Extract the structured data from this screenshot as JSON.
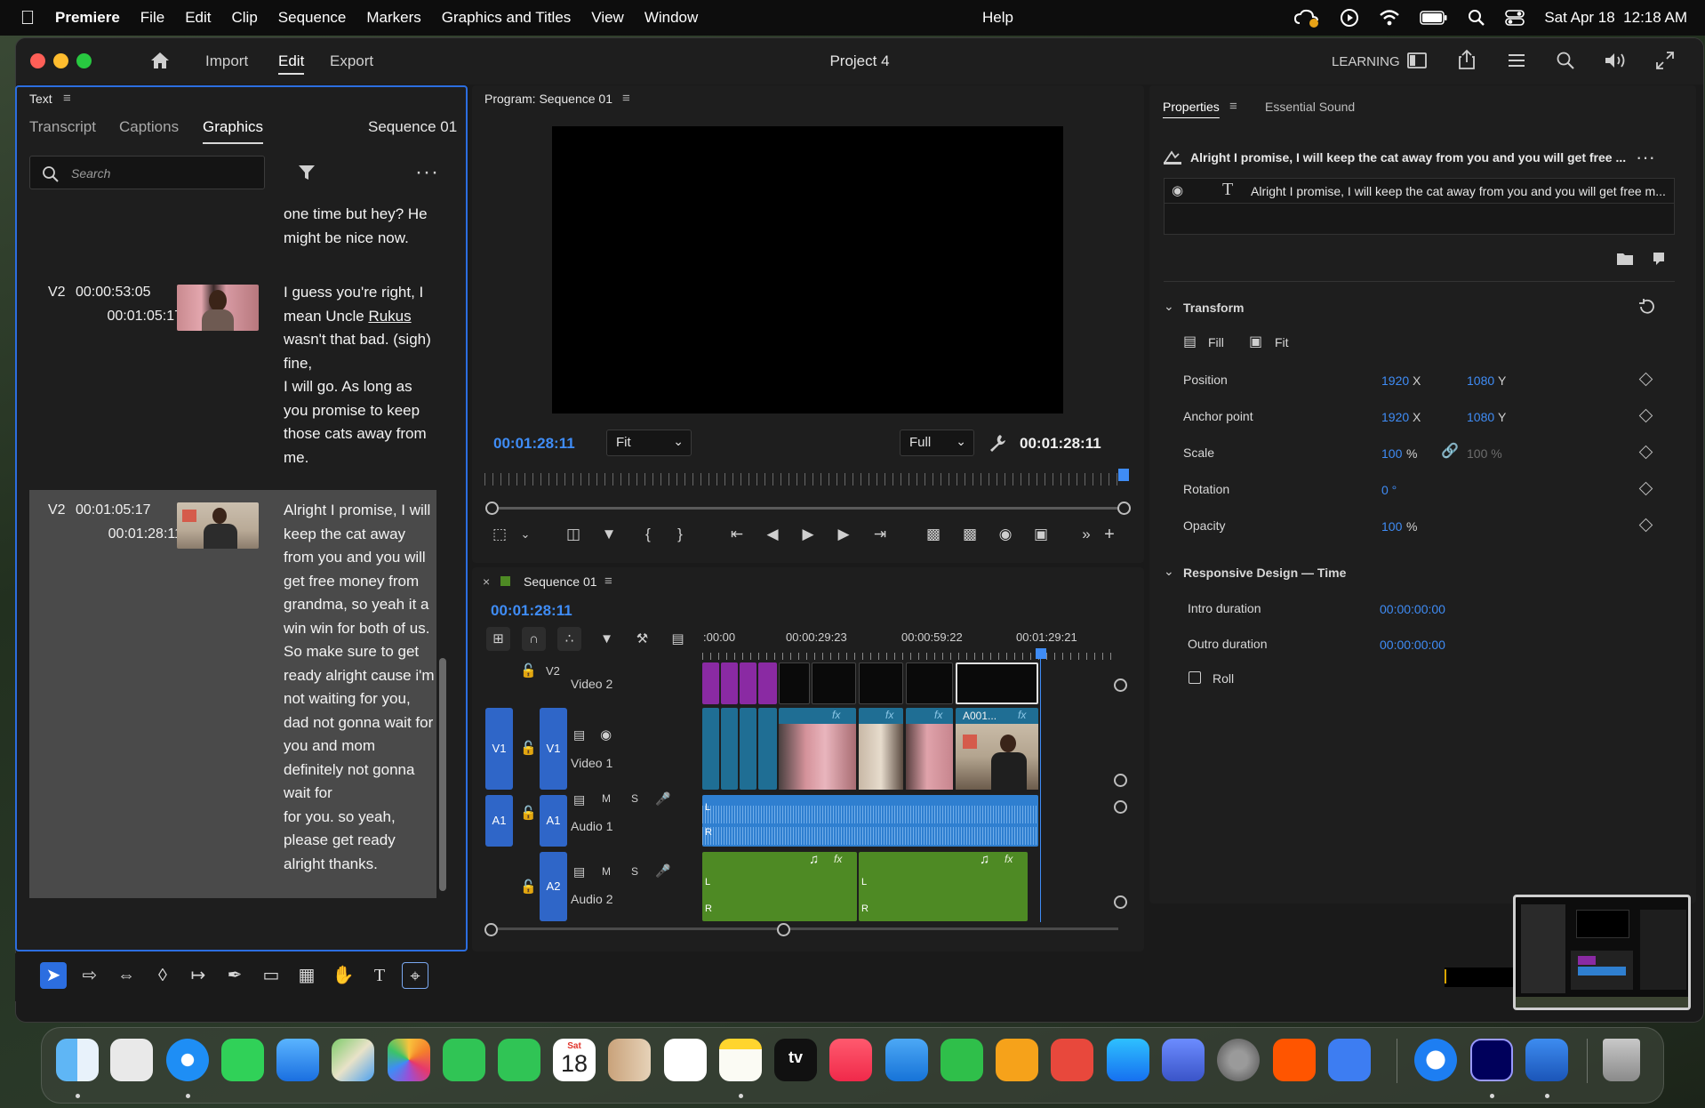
{
  "menubar": {
    "app_name": "Premiere",
    "items": [
      "File",
      "Edit",
      "Clip",
      "Sequence",
      "Markers",
      "Graphics and Titles",
      "View",
      "Window",
      "Help"
    ],
    "clock": "Sat Apr 18  12:18 AM"
  },
  "window": {
    "project_title": "Project 4",
    "nav": {
      "import": "Import",
      "edit": "Edit",
      "export": "Export"
    },
    "learning_label": "LEARNING"
  },
  "text_panel": {
    "title": "Text",
    "tabs": [
      "Transcript",
      "Captions",
      "Graphics"
    ],
    "active_tab": "Graphics",
    "sequence_label": "Sequence 01",
    "search_placeholder": "Search",
    "captions": [
      {
        "text": "one time but hey? He\nmight be nice now."
      },
      {
        "track": "V2",
        "in": "00:00:53:05",
        "out": "00:01:05:17",
        "text_before": "I guess you're right, I\nmean Uncle ",
        "underlined": "Rukus",
        "text_after": "\nwasn't that bad. (sigh)\nfine,\nI will go. As long as\nyou promise to keep\nthose cats away from\nme."
      },
      {
        "track": "V2",
        "in": "00:01:05:17",
        "out": "00:01:28:11",
        "text": "Alright I promise, I will\nkeep the cat away\nfrom you and you will\nget free money from\ngrandma, so yeah it a\nwin win for both of us.\nSo make sure to get\nready alright cause i'm\nnot waiting for you,\ndad not gonna wait for\nyou and mom\ndefinitely not gonna\nwait for\nfor you. so yeah,\nplease get ready\nalright thanks."
      }
    ]
  },
  "program_monitor": {
    "title": "Program: Sequence 01",
    "current_time": "00:01:28:11",
    "duration": "00:01:28:11",
    "fit_label": "Fit",
    "quality_label": "Full"
  },
  "timeline": {
    "close_label": "×",
    "sequence_name": "Sequence 01",
    "current_time": "00:01:28:11",
    "ruler_labels": [
      ":00:00",
      "00:00:29:23",
      "00:00:59:22",
      "00:01:29:21"
    ],
    "tracks": {
      "v2": {
        "label": "V2",
        "name": "Video 2"
      },
      "v1": {
        "source": "V1",
        "label": "V1",
        "name": "Video 1"
      },
      "a1": {
        "source": "A1",
        "label": "A1",
        "name": "Audio 1",
        "mute": "M",
        "solo": "S"
      },
      "a2": {
        "label": "A2",
        "name": "Audio 2",
        "mute": "M",
        "solo": "S"
      }
    },
    "clip_label": "A001...",
    "fx_label": "fx",
    "channel_l": "L",
    "channel_r": "R"
  },
  "properties": {
    "tabs": [
      "Properties",
      "Essential Sound"
    ],
    "clip_title": "Alright I promise, I will keep the cat away from you and you will  get free ...",
    "layer_text": "Alright I promise, I will keep the cat away from you and you will  get free m...",
    "transform_label": "Transform",
    "fill_label": "Fill",
    "fit_label": "Fit",
    "rows": [
      {
        "label": "Position",
        "x": "1920",
        "x_unit": "X",
        "y": "1080",
        "y_unit": "Y"
      },
      {
        "label": "Anchor point",
        "x": "1920",
        "x_unit": "X",
        "y": "1080",
        "y_unit": "Y"
      },
      {
        "label": "Scale",
        "x": "100",
        "x_unit": "%",
        "y": "100 %",
        "y_unit": ""
      },
      {
        "label": "Rotation",
        "x": "0 °",
        "x_unit": "",
        "y": "",
        "y_unit": ""
      },
      {
        "label": "Opacity",
        "x": "100",
        "x_unit": "%",
        "y": "",
        "y_unit": ""
      }
    ],
    "responsive_label": "Responsive Design — Time",
    "intro_label": "Intro duration",
    "intro_value": "00:00:00:00",
    "outro_label": "Outro duration",
    "outro_value": "00:00:00:00",
    "roll_label": "Roll"
  },
  "dock": {
    "calendar_month": "Sat",
    "calendar_day": "18",
    "tv_label": "tv"
  },
  "colors": {
    "accent_blue": "#2c6ee0",
    "timecode_blue": "#3f8cf5",
    "graphics_clip_purple": "#8a2aa3",
    "video_clip_blue": "#1f6e94",
    "audio_clip_blue": "#2f7fd0",
    "audio_clip_green": "#4e8a24"
  }
}
